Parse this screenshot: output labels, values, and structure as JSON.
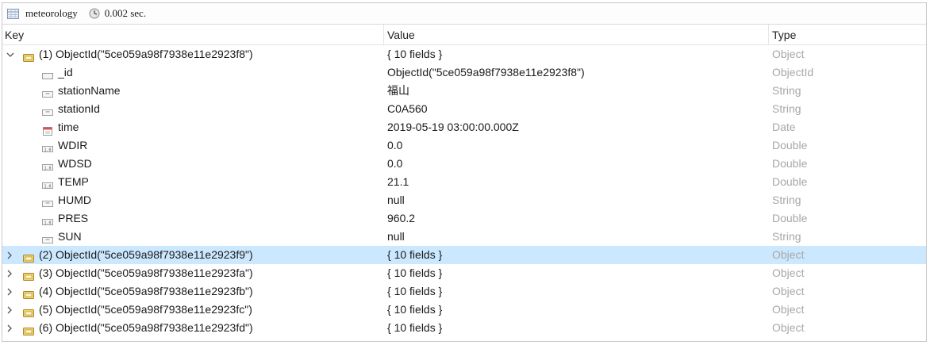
{
  "window": {
    "collection": "meteorology",
    "time": "0.002 sec."
  },
  "columns": {
    "key": "Key",
    "value": "Value",
    "type": "Type"
  },
  "rows": [
    {
      "key": "(1) ObjectId(\"5ce059a98f7938e11e2923f8\")",
      "value": "{ 10 fields }",
      "type": "Object",
      "icon": "object-icon",
      "level": 0,
      "expandable": true,
      "expanded": true,
      "selected": false
    },
    {
      "key": "_id",
      "value": "ObjectId(\"5ce059a98f7938e11e2923f8\")",
      "type": "ObjectId",
      "icon": "objectid-icon",
      "level": 1,
      "expandable": false,
      "expanded": false,
      "selected": false
    },
    {
      "key": "stationName",
      "value": "福山",
      "type": "String",
      "icon": "string-icon",
      "level": 1,
      "expandable": false,
      "expanded": false,
      "selected": false
    },
    {
      "key": "stationId",
      "value": "C0A560",
      "type": "String",
      "icon": "string-icon",
      "level": 1,
      "expandable": false,
      "expanded": false,
      "selected": false
    },
    {
      "key": "time",
      "value": "2019-05-19 03:00:00.000Z",
      "type": "Date",
      "icon": "date-icon",
      "level": 1,
      "expandable": false,
      "expanded": false,
      "selected": false
    },
    {
      "key": "WDIR",
      "value": "0.0",
      "type": "Double",
      "icon": "double-icon",
      "level": 1,
      "expandable": false,
      "expanded": false,
      "selected": false
    },
    {
      "key": "WDSD",
      "value": "0.0",
      "type": "Double",
      "icon": "double-icon",
      "level": 1,
      "expandable": false,
      "expanded": false,
      "selected": false
    },
    {
      "key": "TEMP",
      "value": "21.1",
      "type": "Double",
      "icon": "double-icon",
      "level": 1,
      "expandable": false,
      "expanded": false,
      "selected": false
    },
    {
      "key": "HUMD",
      "value": "null",
      "type": "String",
      "icon": "string-icon",
      "level": 1,
      "expandable": false,
      "expanded": false,
      "selected": false
    },
    {
      "key": "PRES",
      "value": "960.2",
      "type": "Double",
      "icon": "double-icon",
      "level": 1,
      "expandable": false,
      "expanded": false,
      "selected": false
    },
    {
      "key": "SUN",
      "value": "null",
      "type": "String",
      "icon": "string-icon",
      "level": 1,
      "expandable": false,
      "expanded": false,
      "selected": false
    },
    {
      "key": "(2) ObjectId(\"5ce059a98f7938e11e2923f9\")",
      "value": "{ 10 fields }",
      "type": "Object",
      "icon": "object-icon",
      "level": 0,
      "expandable": true,
      "expanded": false,
      "selected": true
    },
    {
      "key": "(3) ObjectId(\"5ce059a98f7938e11e2923fa\")",
      "value": "{ 10 fields }",
      "type": "Object",
      "icon": "object-icon",
      "level": 0,
      "expandable": true,
      "expanded": false,
      "selected": false
    },
    {
      "key": "(4) ObjectId(\"5ce059a98f7938e11e2923fb\")",
      "value": "{ 10 fields }",
      "type": "Object",
      "icon": "object-icon",
      "level": 0,
      "expandable": true,
      "expanded": false,
      "selected": false
    },
    {
      "key": "(5) ObjectId(\"5ce059a98f7938e11e2923fc\")",
      "value": "{ 10 fields }",
      "type": "Object",
      "icon": "object-icon",
      "level": 0,
      "expandable": true,
      "expanded": false,
      "selected": false
    },
    {
      "key": "(6) ObjectId(\"5ce059a98f7938e11e2923fd\")",
      "value": "{ 10 fields }",
      "type": "Object",
      "icon": "object-icon",
      "level": 0,
      "expandable": true,
      "expanded": false,
      "selected": false
    }
  ],
  "colors": {
    "selected_row": "#cce8ff",
    "type_text": "#a7a7a7"
  }
}
